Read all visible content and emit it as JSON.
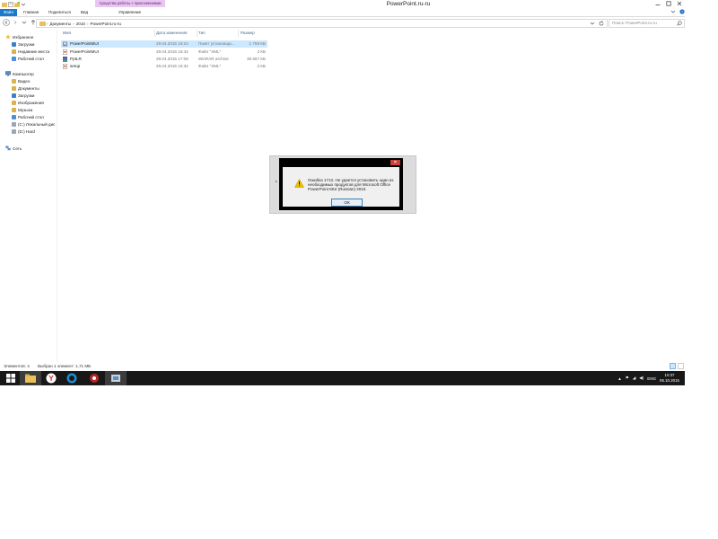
{
  "window": {
    "title": "PowerPoint.ru-ru",
    "context_tab_group": "Средства работы с приложениями"
  },
  "ribbon": {
    "tabs": [
      "Файл",
      "Главная",
      "Поделиться",
      "Вид",
      "Управление"
    ]
  },
  "address": {
    "breadcrumbs": [
      "Документы",
      "2010",
      "PowerPoint.ru-ru"
    ],
    "search_placeholder": "Поиск: PowerPoint.ru-ru"
  },
  "navpane": {
    "favorites": {
      "label": "Избранное",
      "items": [
        "Загрузки",
        "Недавние места",
        "Рабочий стол"
      ]
    },
    "computer": {
      "label": "Компьютер",
      "items": [
        "Видео",
        "Документы",
        "Загрузки",
        "Изображения",
        "Музыка",
        "Рабочий стол",
        "(C:) Локальный дис",
        "(D:) Hard"
      ]
    },
    "network": {
      "label": "Сеть"
    }
  },
  "filelist": {
    "columns": [
      "Имя",
      "Дата изменения",
      "Тип",
      "Размер"
    ],
    "rows": [
      {
        "name": "PowerPointMUI",
        "date": "29.04.2015 18:24",
        "type": "Пакет установщи...",
        "size": "1 759 КБ",
        "icon": "msi-package-icon",
        "selected": true
      },
      {
        "name": "PowerPointMUI",
        "date": "29.04.2015 15:42",
        "type": "Файл \"XML\"",
        "size": "2 КБ",
        "icon": "xml-file-icon",
        "selected": false
      },
      {
        "name": "PptLR",
        "date": "29.04.2015 17:08",
        "type": "WinRAR archive",
        "size": "39 667 КБ",
        "icon": "winrar-archive-icon",
        "selected": false
      },
      {
        "name": "setup",
        "date": "29.04.2015 15:32",
        "type": "Файл \"XML\"",
        "size": "2 КБ",
        "icon": "xml-file-icon",
        "selected": false
      }
    ]
  },
  "status": {
    "count": "Элементов: 4",
    "selected": "Выбран 1 элемент: 1,71 МБ"
  },
  "dialog": {
    "message": "Ошибка 1713. Не удается установить один из необходимых продуктов для Microsoft Office PowerPoint MUI (Russian) 2010.",
    "ok_label": "ОК",
    "close_label": "✕"
  },
  "taskbar": {
    "language": "ENG",
    "time": "10:37",
    "date": "06.10.2015"
  },
  "colors": {
    "file_tab": "#1979ca",
    "context_tab": "#e9c6f1",
    "selection": "#cce8ff",
    "taskbar": "#181818",
    "dialog_close": "#c7403a"
  }
}
